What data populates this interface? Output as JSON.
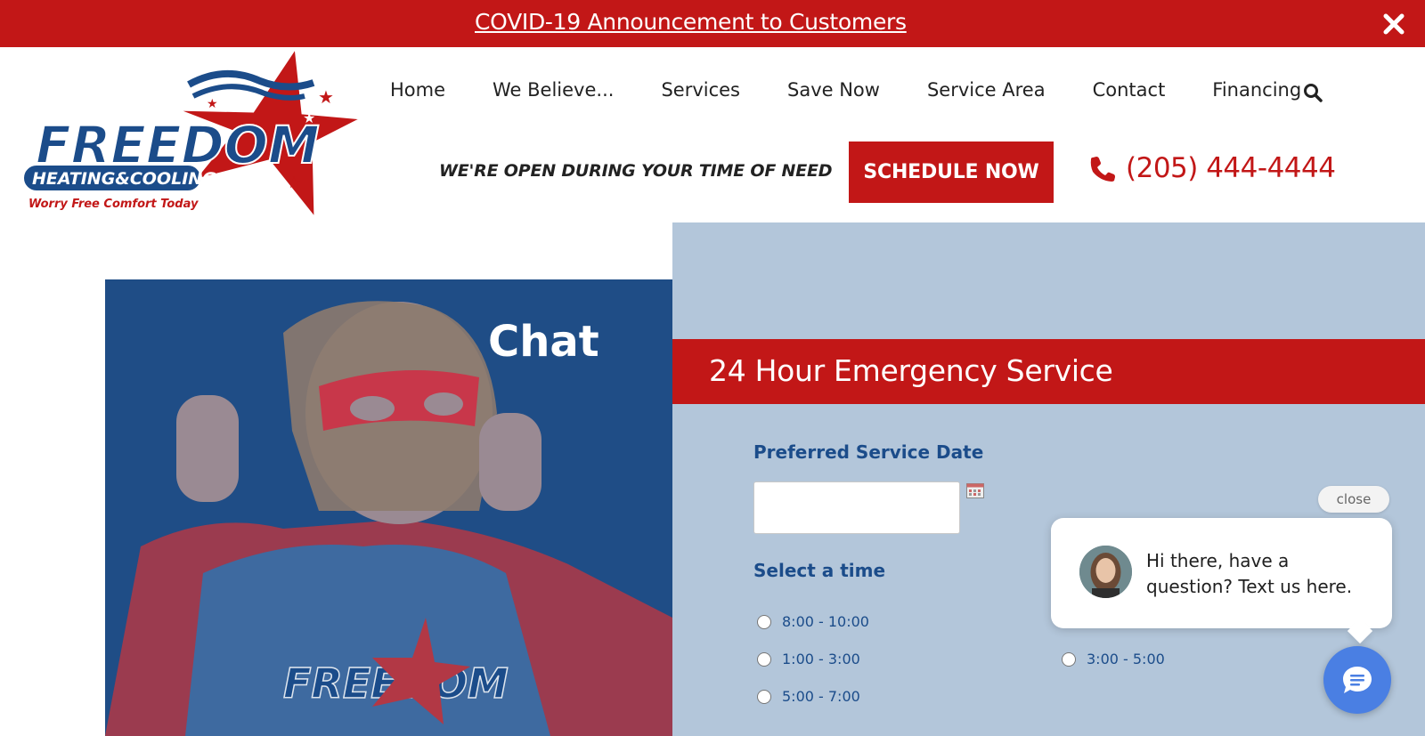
{
  "announcement": {
    "text": "COVID-19 Announcement to Customers",
    "close": "close-icon"
  },
  "logo": {
    "brand": "FREEDOM",
    "sub": "HEATING&COOLING",
    "slogan": "Worry Free Comfort Today"
  },
  "nav": {
    "items": [
      "Home",
      "We Believe...",
      "Services",
      "Save Now",
      "Service Area",
      "Contact",
      "Financing"
    ],
    "search_icon": "search-icon"
  },
  "header": {
    "tagline": "WE'RE OPEN DURING YOUR TIME OF NEED",
    "cta": "SCHEDULE NOW",
    "phone": "(205) 444-4444"
  },
  "hero": {
    "title": "Chat"
  },
  "form": {
    "banner": "24 Hour Emergency Service",
    "date_label": "Preferred Service Date",
    "date_value": "",
    "time_label": "Select a time",
    "times": [
      "8:00 - 10:00",
      "1:00 - 3:00",
      "3:00 - 5:00",
      "5:00 - 7:00"
    ]
  },
  "chat_widget": {
    "close_label": "close",
    "message": "Hi there, have a question? Text us here."
  },
  "colors": {
    "brand_red": "#c21717",
    "brand_blue": "#1b4c8a",
    "panel_blue": "#b3c6da"
  }
}
